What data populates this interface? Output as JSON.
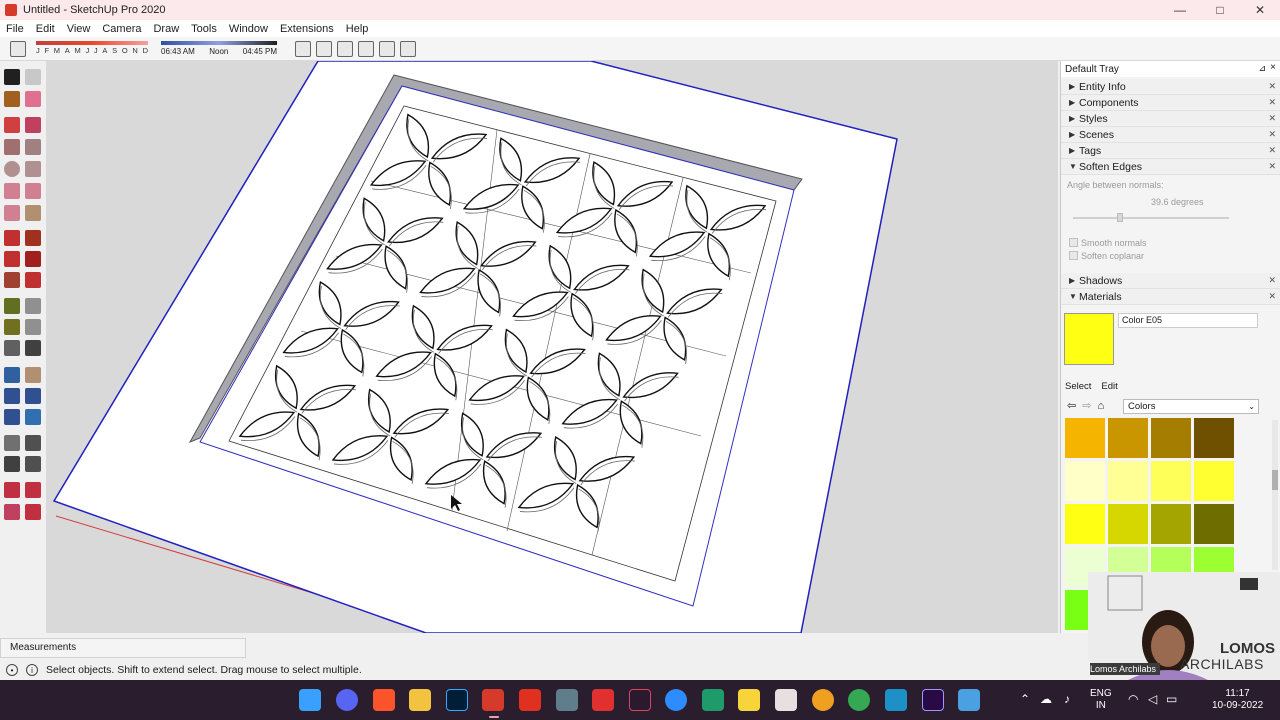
{
  "window": {
    "title": "Untitled - SketchUp Pro 2020",
    "min": "—",
    "max": "□",
    "close": "✕"
  },
  "menu": [
    "File",
    "Edit",
    "View",
    "Camera",
    "Draw",
    "Tools",
    "Window",
    "Extensions",
    "Help"
  ],
  "shadow_settings": {
    "months": [
      "J",
      "F",
      "M",
      "A",
      "M",
      "J",
      "J",
      "A",
      "S",
      "O",
      "N",
      "D"
    ],
    "time_start": "06:43 AM",
    "time_mid": "Noon",
    "time_end": "04:45 PM"
  },
  "tray": {
    "title": "Default Tray",
    "pin": "⊿",
    "close": "×",
    "panels_top": [
      {
        "label": "Entity Info",
        "state": "collapsed"
      },
      {
        "label": "Components",
        "state": "collapsed"
      },
      {
        "label": "Styles",
        "state": "collapsed"
      },
      {
        "label": "Scenes",
        "state": "collapsed"
      },
      {
        "label": "Tags",
        "state": "collapsed"
      },
      {
        "label": "Soften Edges",
        "state": "expanded"
      }
    ],
    "soften": {
      "angle_label": "Angle between normals:",
      "angle_value": "39.6  degrees",
      "slider_fraction": 0.3,
      "smooth_normals": "Smooth normals",
      "soften_coplanar": "Soften coplanar"
    },
    "panels_bottom": [
      {
        "label": "Shadows",
        "state": "collapsed"
      },
      {
        "label": "Materials",
        "state": "expanded"
      }
    ],
    "materials": {
      "current_name": "Color E05",
      "current_color": "#ffff14",
      "tab_select": "Select",
      "tab_edit": "Edit",
      "collection": "Colors",
      "swatches": [
        "#f5b400",
        "#c99600",
        "#a57d00",
        "#6e5000",
        "#ffffc8",
        "#ffff96",
        "#ffff5a",
        "#ffff32",
        "#ffff14",
        "#d7d700",
        "#a5a500",
        "#6e6e00",
        "#ebffd2",
        "#d2ff96",
        "#b4ff5a",
        "#9bff32",
        "#78ff14"
      ]
    }
  },
  "measurements_label": "Measurements",
  "status_text": "Select objects. Shift to extend select. Drag mouse to select multiple.",
  "webcam": {
    "name": "Lomos Archilabs",
    "brand_line1": "LOMOS",
    "brand_line2": "ARCHILABS"
  },
  "taskbar": {
    "lang_1": "ENG",
    "lang_2": "IN",
    "time": "11:17",
    "date": "10-09-2022"
  },
  "colors": {
    "viewport_bg": "#d9d9d9",
    "axis_blue": "#2020c0",
    "axis_red": "#d04040",
    "frame_top": "#ffffff",
    "frame_side": "#a8a8b0"
  }
}
